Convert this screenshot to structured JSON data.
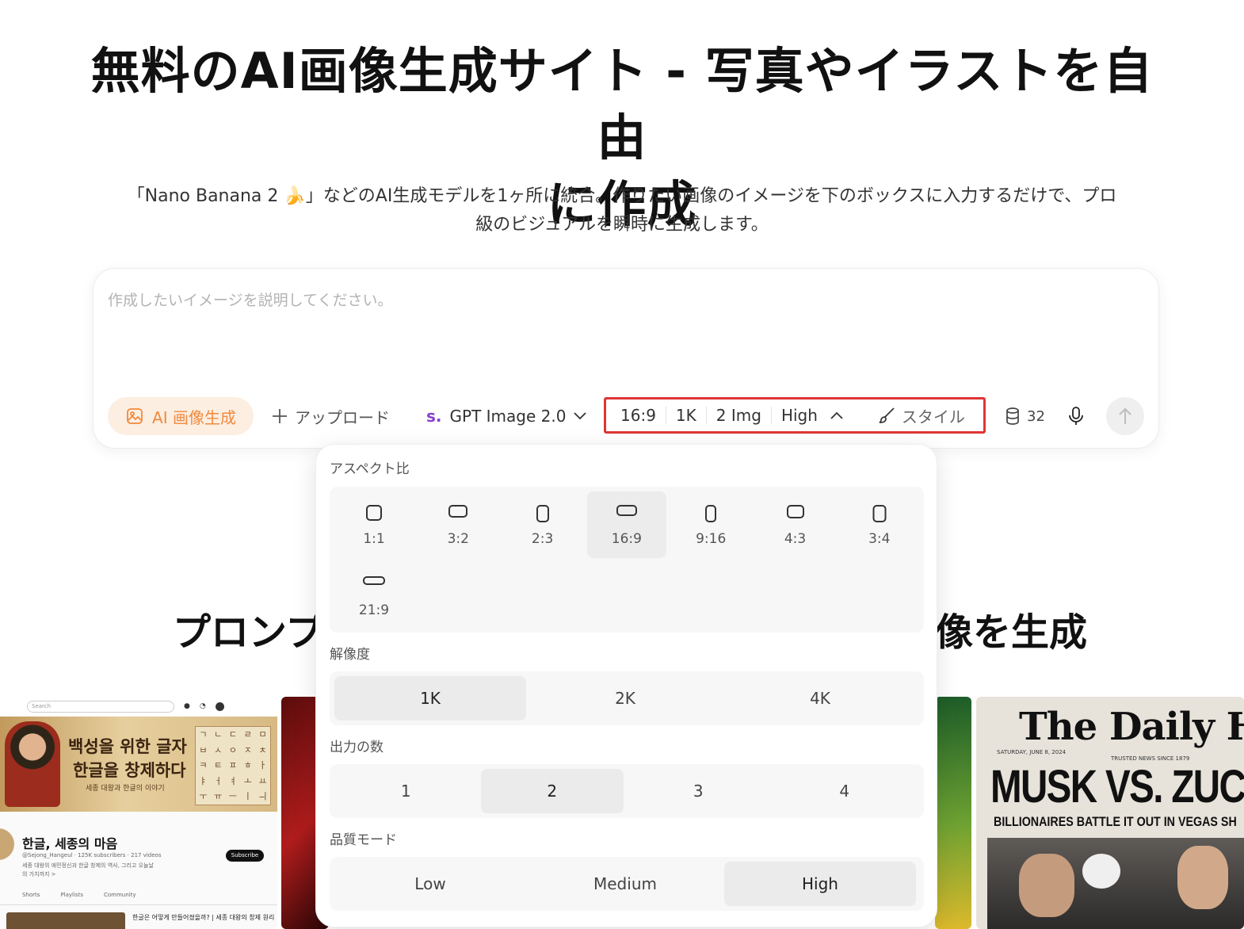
{
  "hero": {
    "title_line1": "無料のAI画像生成サイト - 写真やイラストを自由",
    "title_line2": "に作成",
    "subtitle_line1": "「Nano Banana 2 🍌」などのAI生成モデルを1ヶ所に統合。作りたい画像のイメージを下のボックスに入力するだけで、プロ",
    "subtitle_line2": "級のビジュアルを瞬時に生成します。"
  },
  "prompt": {
    "placeholder": "作成したいイメージを説明してください。",
    "ai_gen_label": "AI 画像生成",
    "upload_label": "アップロード",
    "model_logo": "s.",
    "model_label": "GPT Image 2.0",
    "opt_aspect": "16:9",
    "opt_resolution": "1K",
    "opt_count": "2 Img",
    "opt_quality": "High",
    "style_label": "スタイル",
    "credits": "32"
  },
  "section": {
    "title_left": "プロンプ",
    "title_right": "像を生成"
  },
  "dropdown": {
    "aspect_label": "アスペクト比",
    "aspect_options": [
      "1:1",
      "3:2",
      "2:3",
      "16:9",
      "9:16",
      "4:3",
      "3:4",
      "21:9"
    ],
    "aspect_selected": "16:9",
    "resolution_label": "解像度",
    "resolution_options": [
      "1K",
      "2K",
      "4K"
    ],
    "resolution_selected": "1K",
    "count_label": "出力の数",
    "count_options": [
      "1",
      "2",
      "3",
      "4"
    ],
    "count_selected": "2",
    "quality_label": "品質モード",
    "quality_options": [
      "Low",
      "Medium",
      "High"
    ],
    "quality_selected": "High"
  },
  "gallery": {
    "youtube": {
      "search": "Search",
      "banner_line1": "백성을 위한 글자",
      "banner_line2": "한글을 창제하다",
      "banner_line3": "세종 대왕과 한글의 이야기",
      "grid_chars": [
        "ㄱ",
        "ㄴ",
        "ㄷ",
        "ㄹ",
        "ㅁ",
        "ㅂ",
        "ㅅ",
        "ㅇ",
        "ㅈ",
        "ㅊ",
        "ㅋ",
        "ㅌ",
        "ㅍ",
        "ㅎ",
        "ㅏ",
        "ㅑ",
        "ㅓ",
        "ㅕ",
        "ㅗ",
        "ㅛ",
        "ㅜ",
        "ㅠ",
        "ㅡ",
        "ㅣ",
        "ㅢ"
      ],
      "channel_name": "한글, 세종의 마음",
      "meta": "@Sejong_Hangeul · 125K subscribers · 217 videos",
      "desc": "세종 대왕의 애민정신과 한글 창제의 역사, 그리고 오늘날의 가치까지 >",
      "subscribe": "Subscribe",
      "tabs": [
        "Shorts",
        "Playlists",
        "Community"
      ],
      "video_title": "한글은 어떻게 만들어졌을까? | 세종 대왕의 창제 원리"
    },
    "newspaper": {
      "masthead": "The Daily Hera",
      "date": "SATURDAY, JUNE 8, 2024",
      "trusted": "TRUSTED NEWS SINCE 1879",
      "headline": "MUSK VS. ZUCKERI",
      "subhead": "BILLIONAIRES BATTLE IT OUT IN VEGAS SH"
    }
  },
  "colors": {
    "accent_orange": "#f08a3c",
    "highlight_red": "#e03535",
    "logo_purple": "#8a3fd1"
  }
}
